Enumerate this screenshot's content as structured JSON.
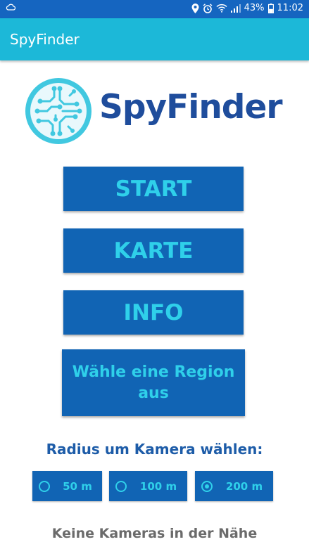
{
  "status_bar": {
    "battery": "43%",
    "time": "11:02",
    "icons": [
      "cloud-icon",
      "location-icon",
      "alarm-icon",
      "wifi-icon",
      "signal-icon",
      "battery-icon"
    ]
  },
  "app_bar": {
    "title": "SpyFinder"
  },
  "logo": {
    "text": "SpyFinder"
  },
  "menu": {
    "start_label": "START",
    "map_label": "KARTE",
    "info_label": "INFO",
    "region_label": "Wähle eine Region aus"
  },
  "radius": {
    "label": "Radius um Kamera wählen:",
    "options": [
      {
        "label": "50 m",
        "selected": false
      },
      {
        "label": "100 m",
        "selected": false
      },
      {
        "label": "200 m",
        "selected": true
      }
    ]
  },
  "status_message": "Keine Kameras in der Nähe",
  "colors": {
    "status_bar": "#1565c0",
    "app_bar": "#1cb8d8",
    "button_bg": "#1164b4",
    "button_text": "#2fd0ea",
    "logo_text": "#1f4d9c",
    "message_text": "#6b6b6b"
  }
}
